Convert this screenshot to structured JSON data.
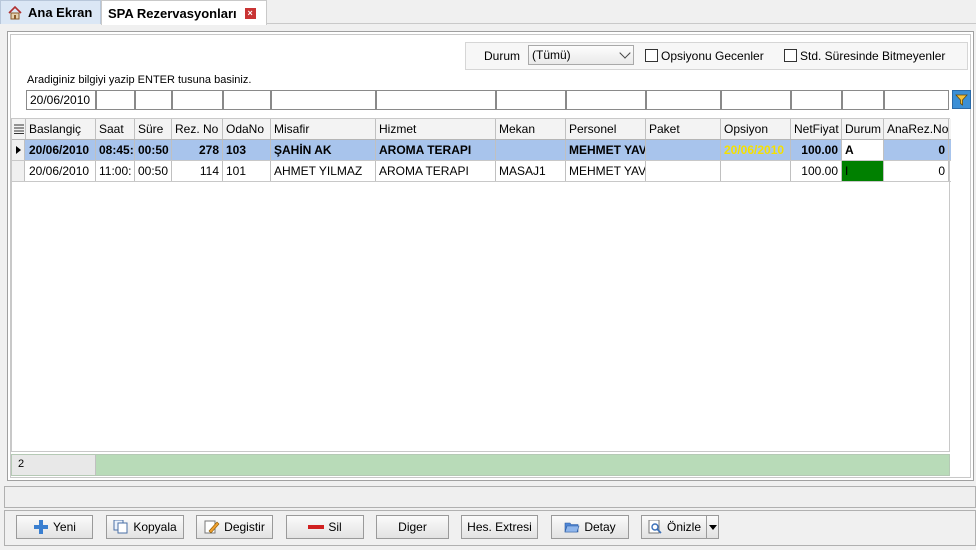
{
  "tabs": [
    {
      "label": "Ana Ekran"
    },
    {
      "label": "SPA Rezervasyonları"
    }
  ],
  "filters": {
    "durum_label": "Durum",
    "durum_value": "(Tümü)",
    "opsiyon_label": "Opsiyonu Gecenler",
    "std_label": "Std. Süresinde Bitmeyenler",
    "hint": "Aradiginiz bilgiyi yazip ENTER tusuna basiniz.",
    "date_value": "20/06/2010"
  },
  "columns": [
    "Baslangiç",
    "Saat",
    "Süre",
    "Rez. No",
    "OdaNo",
    "Misafir",
    "Hizmet",
    "Mekan",
    "Personel",
    "Paket",
    "Opsiyon",
    "NetFiyat",
    "Durum",
    "AnaRez.No"
  ],
  "rows": [
    {
      "baslangic": "20/06/2010",
      "saat": "08:45:",
      "sure": "00:50",
      "rezno": "278",
      "odano": "103",
      "misafir": "ŞAHİN AK",
      "hizmet": "AROMA TERAPI",
      "mekan": "",
      "personel": "MEHMET YAV",
      "paket": "",
      "opsiyon": "20/06/2010",
      "netfiyat": "100.00",
      "durum": "A",
      "anarezno": "0"
    },
    {
      "baslangic": "20/06/2010",
      "saat": "11:00:",
      "sure": "00:50",
      "rezno": "114",
      "odano": "101",
      "misafir": "AHMET YILMAZ",
      "hizmet": "AROMA TERAPI",
      "mekan": "MASAJ1",
      "personel": "MEHMET YAV.",
      "paket": "",
      "opsiyon": "",
      "netfiyat": "100.00",
      "durum": "I",
      "anarezno": "0"
    }
  ],
  "footer": {
    "count": "2"
  },
  "buttons": {
    "yeni": "Yeni",
    "kopyala": "Kopyala",
    "degistir": "Degistir",
    "sil": "Sil",
    "diger": "Diger",
    "hes_extresi": "Hes. Extresi",
    "detay": "Detay",
    "onizle": "Önizle"
  },
  "colors": {
    "selected_row": "#a8c4ec",
    "status_green": "#008000",
    "opsiyon_yellow": "#f5e000"
  }
}
